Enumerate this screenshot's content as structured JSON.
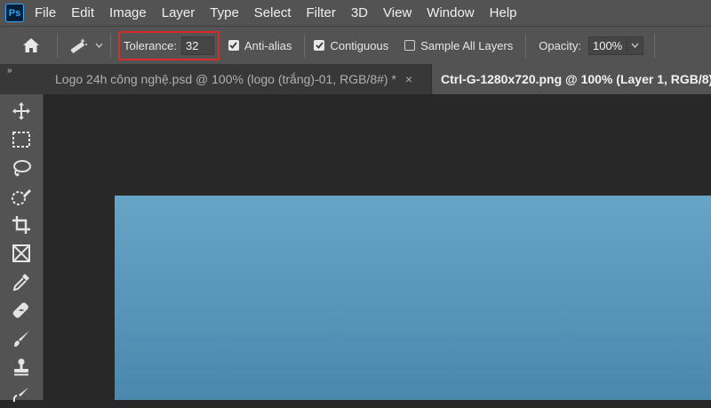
{
  "app": {
    "logo_text": "Ps"
  },
  "menu": [
    "File",
    "Edit",
    "Image",
    "Layer",
    "Type",
    "Select",
    "Filter",
    "3D",
    "View",
    "Window",
    "Help"
  ],
  "options": {
    "tolerance_label": "Tolerance:",
    "tolerance_value": "32",
    "anti_alias_label": "Anti-alias",
    "anti_alias_checked": true,
    "contiguous_label": "Contiguous",
    "contiguous_checked": true,
    "sample_all_layers_label": "Sample All Layers",
    "sample_all_layers_checked": false,
    "opacity_label": "Opacity:",
    "opacity_value": "100%"
  },
  "tabs": [
    {
      "title": "Logo 24h công nghệ.psd @ 100% (logo (trắng)-01, RGB/8#) *",
      "active": false,
      "close": "×"
    },
    {
      "title": "Ctrl-G-1280x720.png @ 100% (Layer 1, RGB/8)",
      "active": true
    }
  ],
  "panel_toggle": "»",
  "tools": [
    "move-tool",
    "marquee-tool",
    "lasso-tool",
    "quick-selection-tool",
    "crop-tool",
    "frame-tool",
    "eyedropper-tool",
    "healing-brush-tool",
    "brush-tool",
    "clone-stamp-tool",
    "history-brush-tool"
  ],
  "colors": {
    "accent_highlight": "#d62b2b",
    "canvas_bg": "#282828",
    "ui_panel": "#535353",
    "document_fill": "#5b99bd"
  }
}
